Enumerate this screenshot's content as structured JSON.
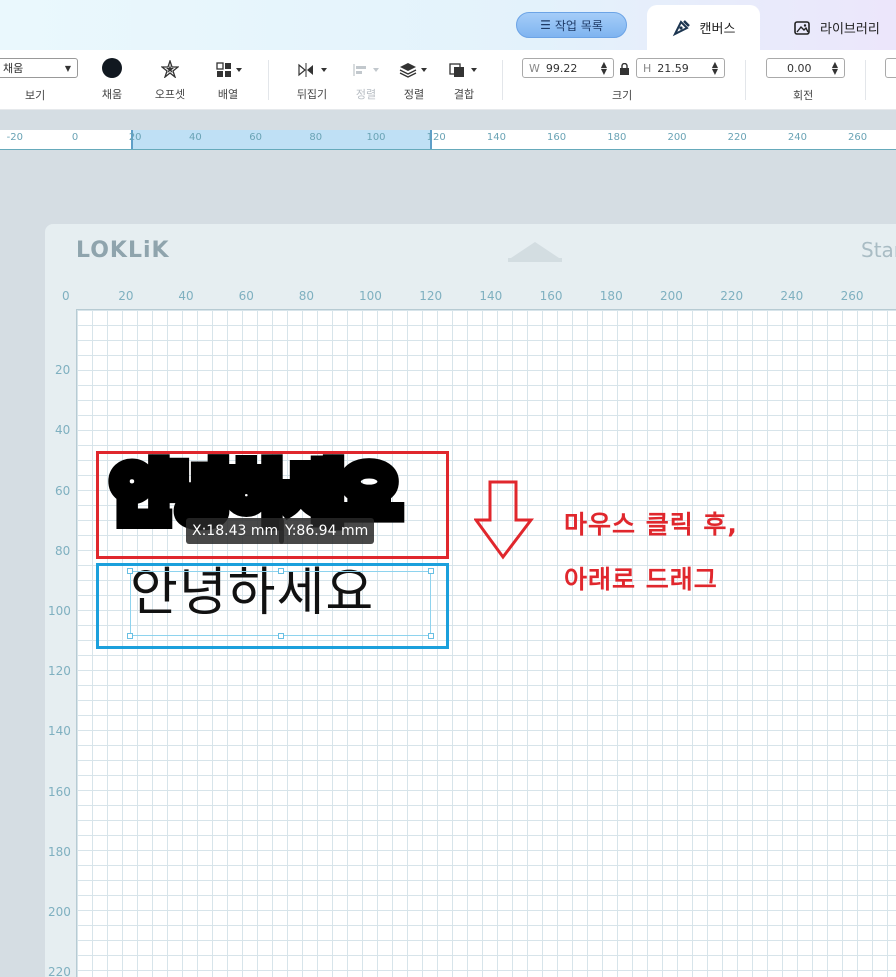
{
  "header": {
    "worklist_label": "작업 목록",
    "tabs": [
      {
        "label": "캔버스",
        "icon": "pen-tool-icon",
        "active": true
      },
      {
        "label": "라이브러리",
        "icon": "image-library-icon",
        "active": false
      }
    ]
  },
  "toolbar": {
    "view": {
      "select_value": "채움",
      "label": "보기"
    },
    "fill": {
      "label": "채움",
      "color": "#111820"
    },
    "offset": {
      "label": "오프셋"
    },
    "arrange": {
      "label": "배열"
    },
    "flip": {
      "label": "뒤집기"
    },
    "align_disabled": {
      "label": "정렬"
    },
    "order": {
      "label": "정렬"
    },
    "combine": {
      "label": "결합"
    },
    "size": {
      "label": "크기",
      "w_key": "W",
      "w_value": "99.22",
      "h_key": "H",
      "h_value": "21.59"
    },
    "rotate": {
      "label": "회전",
      "value": "0.00"
    }
  },
  "top_ruler": {
    "ticks": [
      "-20",
      "0",
      "20",
      "40",
      "60",
      "80",
      "100",
      "120",
      "140",
      "160",
      "180",
      "200",
      "220",
      "240",
      "260"
    ],
    "selection_range": [
      20,
      120
    ]
  },
  "mat": {
    "logo": "LOKLiK",
    "start_label": "Star",
    "x_ticks": [
      "0",
      "20",
      "40",
      "60",
      "80",
      "100",
      "120",
      "140",
      "160",
      "180",
      "200",
      "220",
      "240",
      "260"
    ],
    "y_ticks": [
      "20",
      "40",
      "60",
      "80",
      "100",
      "120",
      "140",
      "160",
      "180",
      "200",
      "220"
    ]
  },
  "canvas": {
    "offset_text": "안녕하세요",
    "main_text": "안녕하세요",
    "coord_x": "X:18.43 mm",
    "coord_y": "Y:86.94 mm",
    "red_color": "#e0272d",
    "blue_color": "#1ba0dc"
  },
  "instruction": {
    "line1": "마우스 클릭 후,",
    "line2": "아래로 드래그"
  }
}
